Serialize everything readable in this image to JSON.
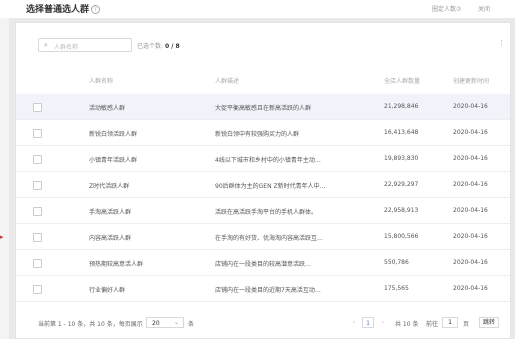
{
  "dialog": {
    "title": "选择普通选人群",
    "help_glyph": "?",
    "right_help": "圈定人数⑦",
    "right_close": "关闭"
  },
  "toolbar": {
    "search_placeholder": "人群名称",
    "selected_label": "已选个数:",
    "selected_value": "0 / 8",
    "more_glyph": "⋮"
  },
  "table": {
    "headers": [
      "人群名称",
      "人群描述",
      "全店人群数量",
      "创建更新时间"
    ],
    "rows": [
      {
        "name": "活动敏感人群",
        "desc": "大促平衡高敏感且在新高活跃的人群",
        "count": "21,298,846",
        "date": "2020-04-16"
      },
      {
        "name": "新锐白领活跃人群",
        "desc": "新锐白领中有较强购买力的人群",
        "count": "16,413,648",
        "date": "2020-04-16"
      },
      {
        "name": "小镇青年活跃人群",
        "desc": "4线以下城市和乡村中的小镇青年主动…",
        "count": "19,893,830",
        "date": "2020-04-16"
      },
      {
        "name": "Z时代活跃人群",
        "desc": "90后群体为主的GEN Z新时代青年人中…",
        "count": "22,929,297",
        "date": "2020-04-16"
      },
      {
        "name": "手淘高活跃人群",
        "desc": "活跃在高活跃手淘平台的手机人群体。",
        "count": "22,958,913",
        "date": "2020-04-16"
      },
      {
        "name": "内容高活跃人群",
        "desc": "在手淘的有好货、优海淘内容高活跃互…",
        "count": "15,800,566",
        "date": "2020-04-16"
      },
      {
        "name": "预热期较高意活人群",
        "desc": "店铺内在一段类目的较高潜意活跃…",
        "count": "550,786",
        "date": "2020-04-16"
      },
      {
        "name": "行业偏好人群",
        "desc": "店铺内在一段类目的近期7天高活互动…",
        "count": "175,565",
        "date": "2020-04-16"
      }
    ]
  },
  "footer": {
    "range_text": "当前第 1 - 10 条，共 10 条，每页展示",
    "page_size": "20",
    "unit": "条",
    "prev": "‹",
    "current_page": "1",
    "next": "›",
    "total_pages": "共 10 条",
    "goto_label": "前往",
    "goto_value": "1",
    "page_unit": "页",
    "go_button": "跳转"
  },
  "colors": {
    "accent": "#4a7bd0",
    "highlight_row": "#f0f4fa"
  },
  "icons": {
    "search": "search-icon",
    "more": "more-vertical-icon",
    "dropdown": "chevron-down-icon"
  }
}
